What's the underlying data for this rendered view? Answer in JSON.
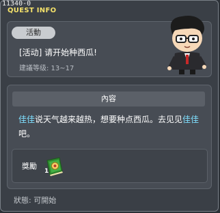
{
  "window": {
    "id_label": "11340-0",
    "title": "QUEST INFO"
  },
  "quest": {
    "category": "活動",
    "name": "[活动] 请开始种西瓜!",
    "level": "建議等级: 13~17"
  },
  "content": {
    "header": "內容",
    "description_parts": [
      "佳佳",
      "说天气越来越热，想要种点西瓜。去见见",
      "佳佳",
      "吧。"
    ],
    "highlight_color": "#7fe0ff"
  },
  "reward": {
    "label": "獎勵",
    "item_icon": "green-book-icon",
    "quantity": "1"
  },
  "status": {
    "text": "狀態: 可開始"
  },
  "colors": {
    "title": "#f5e26a",
    "background": "#3a3f46"
  }
}
